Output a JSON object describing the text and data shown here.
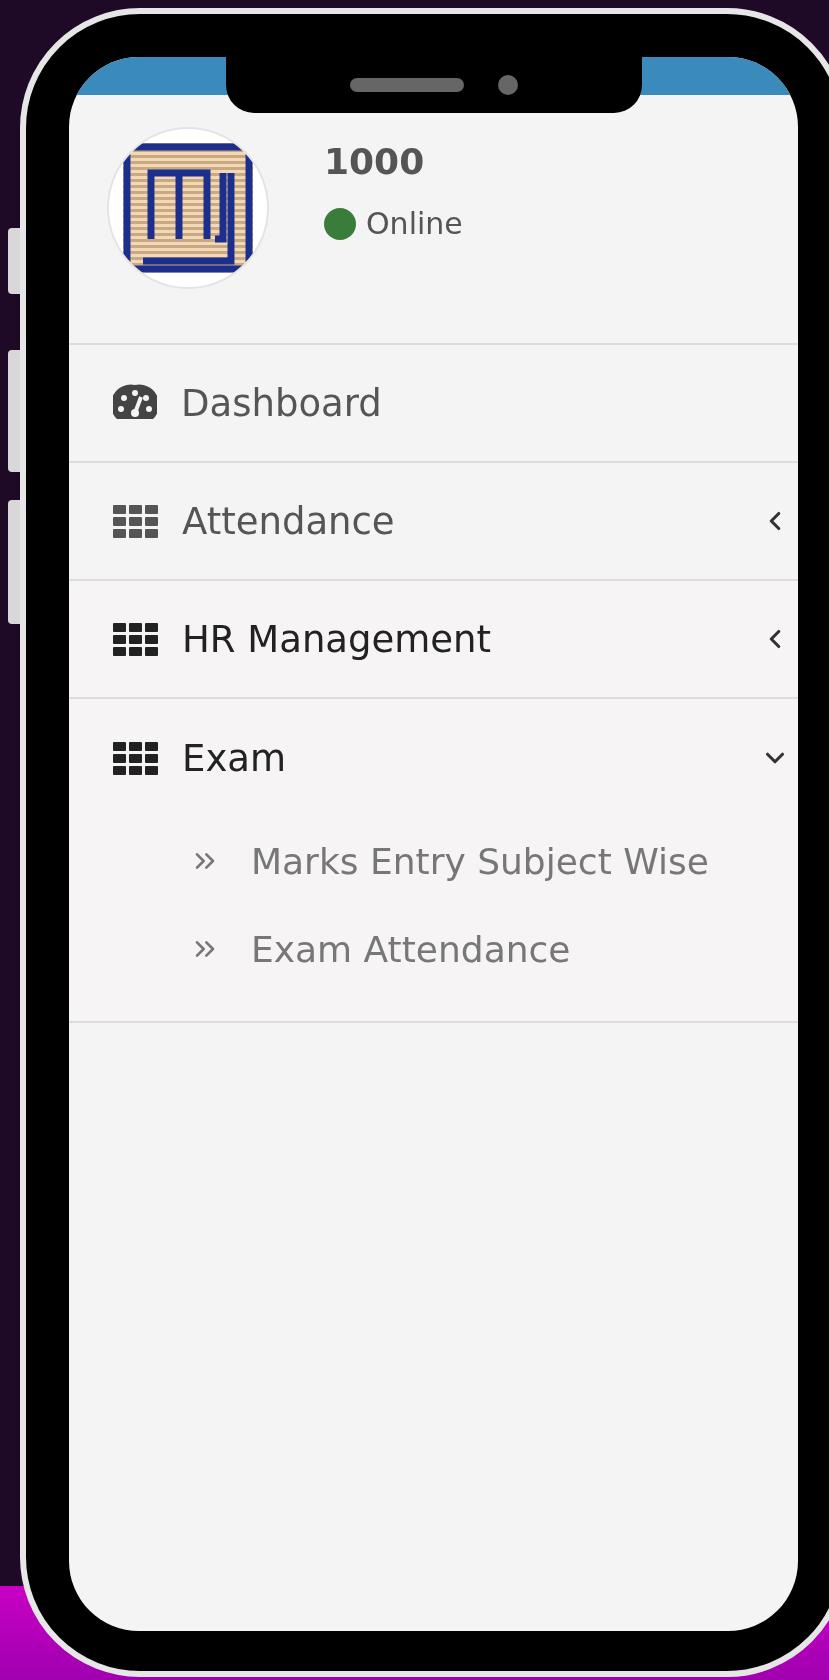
{
  "user": {
    "name": "1000",
    "status": {
      "label": "Online",
      "color": "#3a7d3a"
    }
  },
  "menu": [
    {
      "label": "Dashboard",
      "kind": "link"
    },
    {
      "label": "Attendance",
      "kind": "group",
      "expanded": false
    },
    {
      "label": "HR Management",
      "kind": "group",
      "expanded": false
    },
    {
      "label": "Exam",
      "kind": "group",
      "expanded": true,
      "children": [
        {
          "label": "Marks Entry Subject Wise"
        },
        {
          "label": "Exam Attendance"
        }
      ]
    }
  ]
}
